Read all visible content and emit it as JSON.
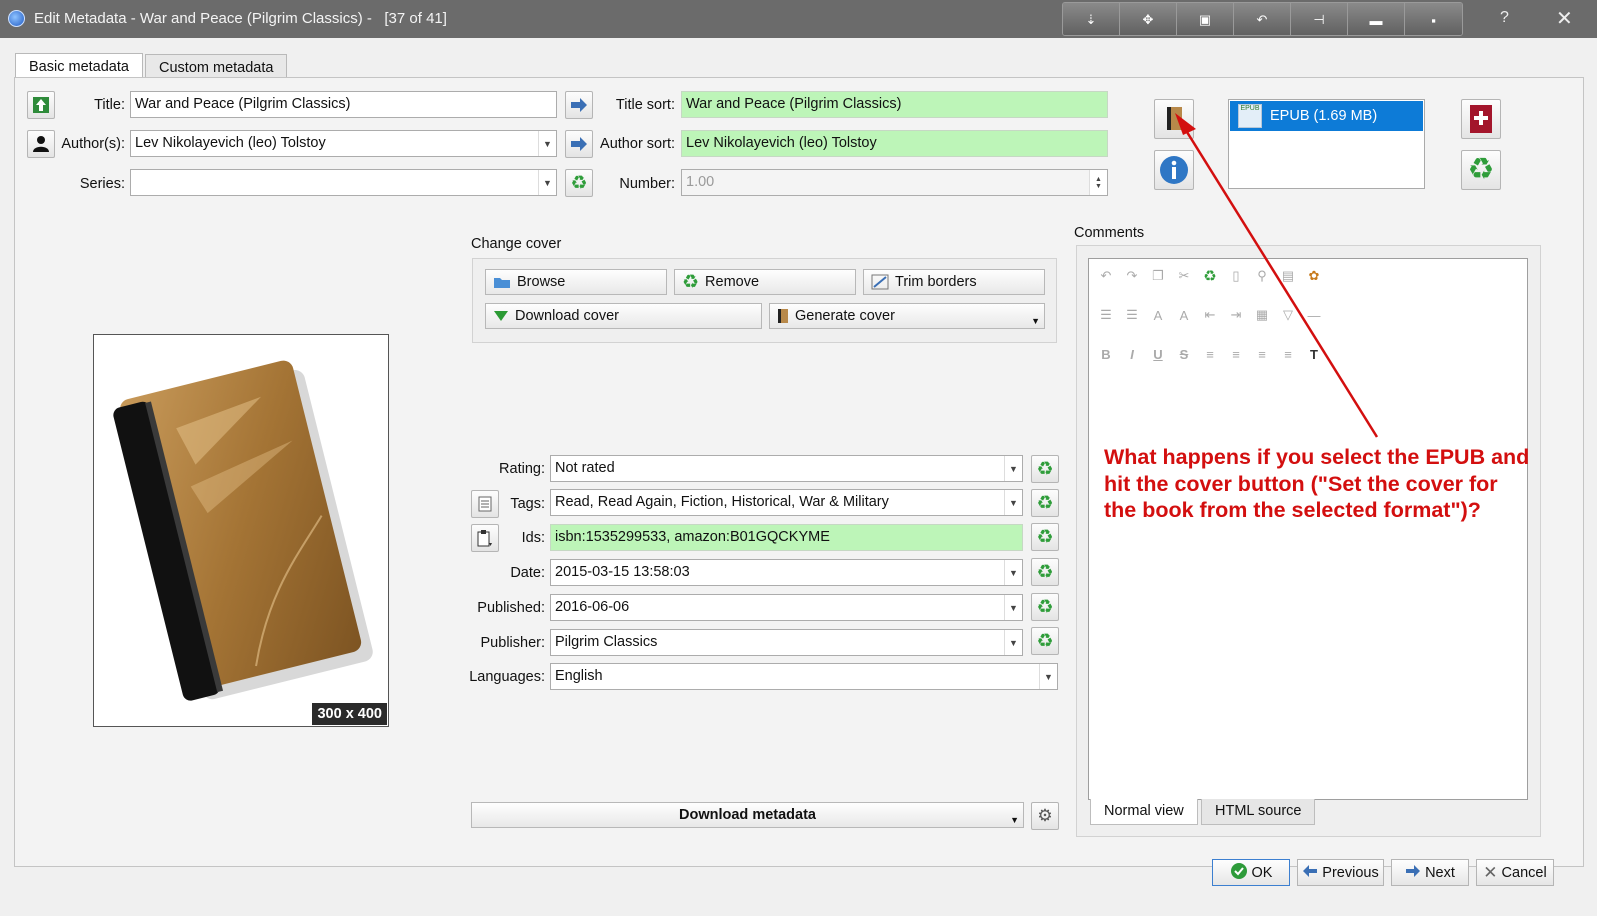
{
  "window": {
    "title": "Edit Metadata - War and Peace (Pilgrim Classics) -   [37 of 41]",
    "toolbar_icons": [
      "minimize-to-tray-icon",
      "pin-icon",
      "restore-icon",
      "undo-icon",
      "tool-icon",
      "dash-icon",
      "dot-icon"
    ],
    "help": "?",
    "close": "✕"
  },
  "tabs": [
    {
      "label": "Basic metadata",
      "active": true
    },
    {
      "label": "Custom metadata",
      "active": false
    }
  ],
  "fields": {
    "title_label": "Title:",
    "title": "War and Peace (Pilgrim Classics)",
    "title_sort_label": "Title sort:",
    "title_sort": "War and Peace (Pilgrim Classics)",
    "authors_label": "Author(s):",
    "authors": "Lev Nikolayevich (leo) Tolstoy",
    "author_sort_label": "Author sort:",
    "author_sort": "Lev Nikolayevich (leo) Tolstoy",
    "series_label": "Series:",
    "series": "",
    "number_label": "Number:",
    "number": "1.00",
    "rating_label": "Rating:",
    "rating": "Not rated",
    "tags_label": "Tags:",
    "tags": "Read, Read Again, Fiction, Historical, War & Military",
    "ids_label": "Ids:",
    "ids": "isbn:1535299533, amazon:B01GQCKYME",
    "date_label": "Date:",
    "date": "2015-03-15 13:58:03",
    "published_label": "Published:",
    "published": "2016-06-06",
    "publisher_label": "Publisher:",
    "publisher": "Pilgrim Classics",
    "languages_label": "Languages:",
    "languages": "English"
  },
  "cover": {
    "section_label": "Change cover",
    "browse": "Browse",
    "remove": "Remove",
    "trim": "Trim borders",
    "download": "Download cover",
    "generate": "Generate cover",
    "dimensions": "300 x 400"
  },
  "formats": {
    "items": [
      {
        "label": "EPUB (1.69 MB)",
        "selected": true
      }
    ]
  },
  "comments": {
    "label": "Comments",
    "views": [
      "Normal view",
      "HTML source"
    ]
  },
  "download_metadata": "Download metadata",
  "annotation": "What happens if you select the EPUB and hit the cover button (\"Set the cover for the book from the selected format\")?",
  "buttons": {
    "ok": "OK",
    "previous": "Previous",
    "next": "Next",
    "cancel": "Cancel"
  },
  "colors": {
    "title_bar": "#6b6b6b",
    "sort_field_green": "#bdf5b8",
    "selection_blue": "#0d7bd7",
    "annotation_red": "#d30f0f",
    "recycle_green": "#2f9d3a"
  }
}
